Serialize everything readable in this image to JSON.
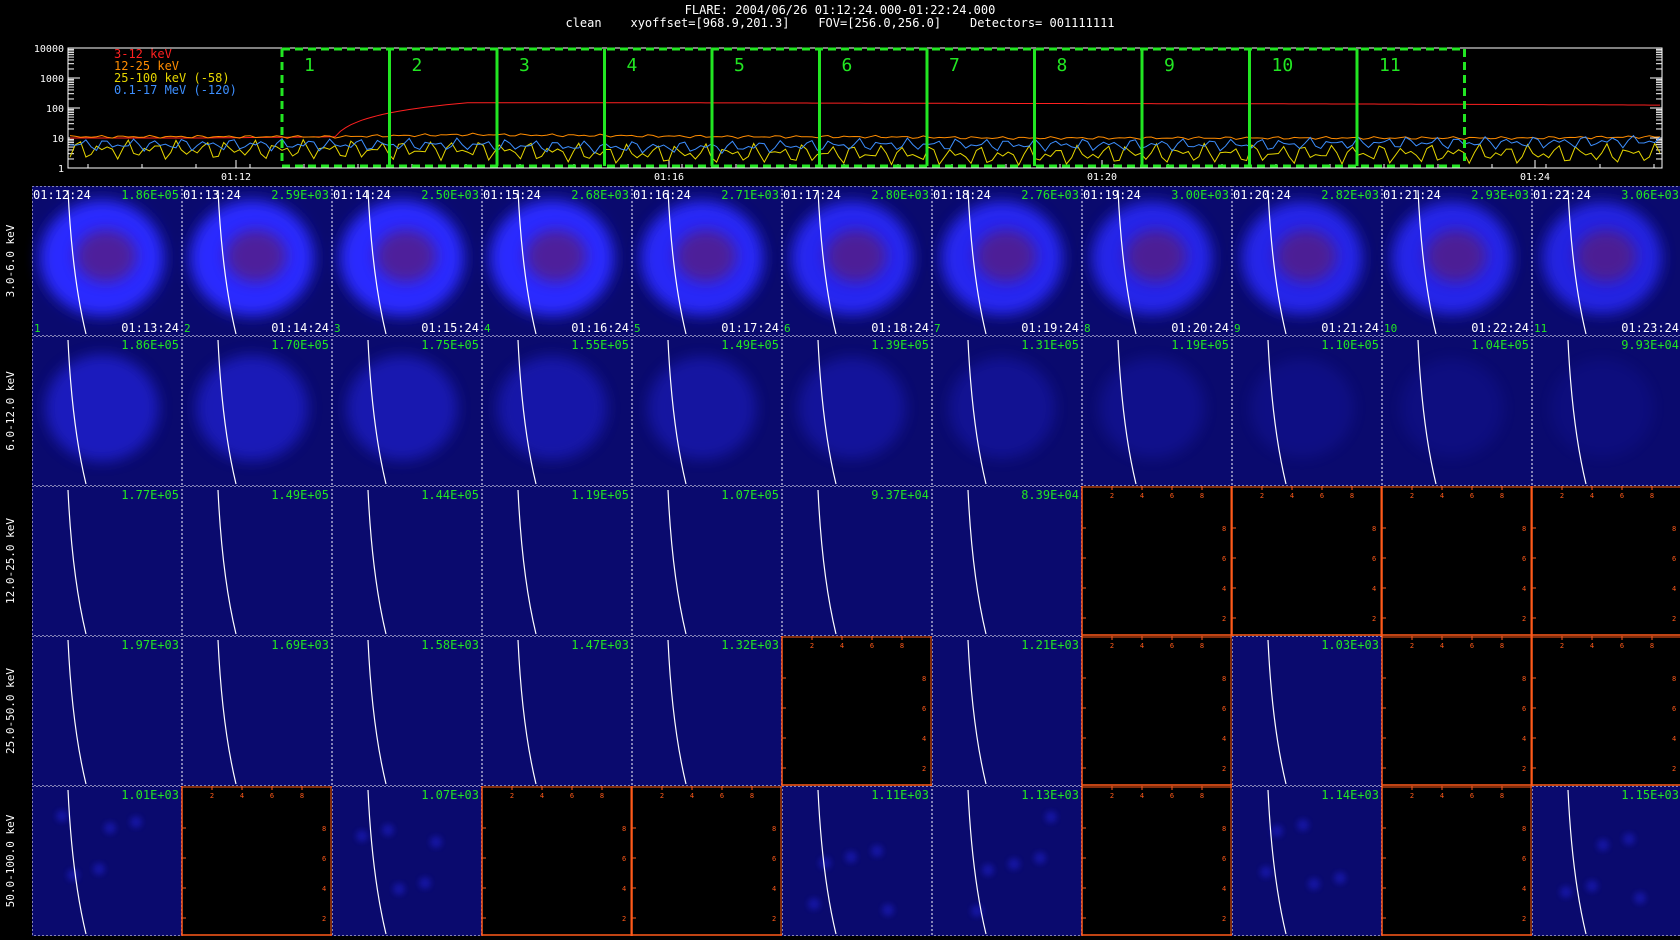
{
  "header": {
    "line1": "FLARE: 2004/06/26 01:12:24.000-01:22:24.000",
    "line2": "clean    xyoffset=[968.9,201.3]    FOV=[256.0,256.0]    Detectors= 001111111"
  },
  "chart_data": [
    {
      "type": "line",
      "scale": "log",
      "ylim": [
        1,
        10000
      ],
      "ytick_labels": [
        "1",
        "10",
        "100",
        "1000",
        "10000"
      ],
      "xtick_labels": [
        "01:12",
        "01:16",
        "01:20",
        "01:24"
      ],
      "legend_placement": "top-left",
      "series": [
        {
          "name": "3-12 keV",
          "color": "#ff2020",
          "values": [
            10,
            10,
            11,
            150,
            150,
            148,
            145,
            142,
            140,
            138,
            135,
            130,
            125
          ]
        },
        {
          "name": "12-25 keV",
          "color": "#ff8c00",
          "values": [
            11,
            11,
            11,
            13,
            12,
            11,
            11,
            10,
            10,
            10,
            10,
            10,
            11
          ]
        },
        {
          "name": "25-100 keV (-58)",
          "color": "#e6d600",
          "values": [
            4,
            4,
            4,
            4,
            3,
            3,
            3,
            2.5,
            3,
            3,
            3,
            3,
            3
          ]
        },
        {
          "name": "0.1-17 MeV (-120)",
          "color": "#3d8fff",
          "values": [
            6,
            6,
            6,
            6,
            5,
            5,
            6,
            6,
            6,
            6,
            7,
            7,
            8
          ]
        }
      ],
      "intervals": [
        "1",
        "2",
        "3",
        "4",
        "5",
        "6",
        "7",
        "8",
        "9",
        "10",
        "11"
      ],
      "interval_color": "#22e622"
    },
    {
      "type": "heatmap",
      "energy_bands": [
        "3.0-6.0 keV",
        "6.0-12.0 keV",
        "12.0-25.0 keV",
        "25.0-50.0 keV",
        "50.0-100.0 keV"
      ],
      "start_times": [
        "01:12:24",
        "01:13:24",
        "01:14:24",
        "01:15:24",
        "01:16:24",
        "01:17:24",
        "01:18:24",
        "01:19:24",
        "01:20:24",
        "01:21:24",
        "01:22:24"
      ],
      "end_times": [
        "01:13:24",
        "01:14:24",
        "01:15:24",
        "01:16:24",
        "01:17:24",
        "01:18:24",
        "01:19:24",
        "01:20:24",
        "01:21:24",
        "01:22:24",
        "01:23:24"
      ],
      "frame_numbers": [
        "1",
        "2",
        "3",
        "4",
        "5",
        "6",
        "7",
        "8",
        "9",
        "10",
        "11"
      ],
      "intensity_max": [
        [
          "1.86E+05",
          "2.59E+03",
          "2.50E+03",
          "2.68E+03",
          "2.71E+03",
          "2.80E+03",
          "2.76E+03",
          "3.00E+03",
          "2.82E+03",
          "2.93E+03",
          "3.06E+03"
        ],
        [
          "1.86E+05",
          "1.70E+05",
          "1.75E+05",
          "1.55E+05",
          "1.49E+05",
          "1.39E+05",
          "1.31E+05",
          "1.19E+05",
          "1.10E+05",
          "1.04E+05",
          "9.93E+04"
        ],
        [
          "1.77E+05",
          "1.49E+05",
          "1.44E+05",
          "1.19E+05",
          "1.07E+05",
          "9.37E+04",
          "8.39E+04",
          "",
          "",
          "",
          ""
        ],
        [
          "1.97E+03",
          "1.69E+03",
          "1.58E+03",
          "1.47E+03",
          "1.32E+03",
          "",
          "1.21E+03",
          "",
          "1.03E+03",
          "",
          ""
        ],
        [
          "1.01E+03",
          "",
          "1.07E+03",
          "",
          "",
          "1.11E+03",
          "1.13E+03",
          "",
          "1.14E+03",
          "",
          "1.15E+03"
        ]
      ],
      "source_strength": [
        [
          1.0,
          1.0,
          1.0,
          1.0,
          0.95,
          0.9,
          0.9,
          0.85,
          0.85,
          0.85,
          0.8
        ],
        [
          0.55,
          0.5,
          0.45,
          0.4,
          0.35,
          0.3,
          0.25,
          0.2,
          0.15,
          0.12,
          0.1
        ],
        [
          0,
          0,
          0,
          0,
          0,
          0,
          0,
          0,
          0,
          0,
          0
        ],
        [
          0,
          0,
          0,
          0,
          0,
          0,
          0,
          0,
          0,
          0,
          0
        ],
        [
          0.05,
          0,
          0.05,
          0,
          0,
          0.05,
          0.05,
          0,
          0.05,
          0,
          0.05
        ]
      ],
      "image_color": "#0a0a6e",
      "source_color": "#2a2aff",
      "core_color": "#5a1e7a",
      "time_label_color": "#ffffff",
      "max_label_color": "#22e622",
      "empty_axis_color": "#ff5a1a",
      "empty_tick_labels": [
        "2",
        "4",
        "6",
        "8"
      ]
    }
  ]
}
